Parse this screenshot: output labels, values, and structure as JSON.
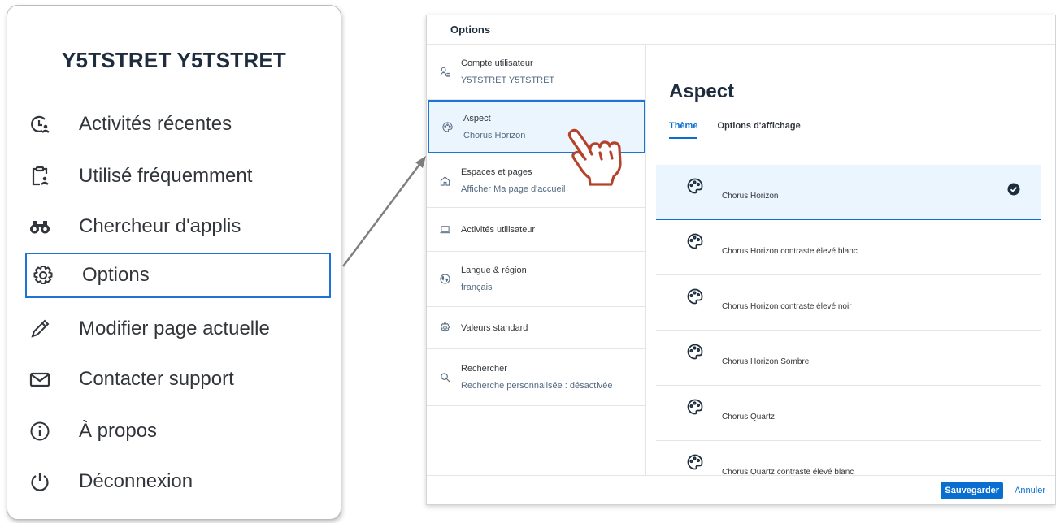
{
  "user_menu": {
    "user_name": "Y5TSTRET Y5TSTRET",
    "items": [
      {
        "label": "Activités récentes",
        "icon": "recent-activity-icon"
      },
      {
        "label": "Utilisé fréquemment",
        "icon": "frequently-used-icon"
      },
      {
        "label": "Chercheur d'applis",
        "icon": "binoculars-icon"
      },
      {
        "label": "Options",
        "icon": "gear-icon",
        "selected": true
      },
      {
        "label": "Modifier page actuelle",
        "icon": "pencil-icon"
      },
      {
        "label": "Contacter support",
        "icon": "envelope-icon"
      },
      {
        "label": "À propos",
        "icon": "info-icon"
      },
      {
        "label": "Déconnexion",
        "icon": "power-icon"
      }
    ]
  },
  "dialog": {
    "title": "Options",
    "nav": [
      {
        "title": "Compte utilisateur",
        "sub": "Y5TSTRET Y5TSTRET",
        "icon": "user-icon"
      },
      {
        "title": "Aspect",
        "sub": "Chorus Horizon",
        "icon": "palette-icon",
        "active": true
      },
      {
        "title": "Espaces et pages",
        "sub": "Afficher Ma page d'accueil",
        "icon": "home-icon"
      },
      {
        "title": "Activités utilisateur",
        "sub": "",
        "icon": "laptop-icon"
      },
      {
        "title": "Langue & région",
        "sub": "français",
        "icon": "globe-icon"
      },
      {
        "title": "Valeurs standard",
        "sub": "",
        "icon": "settings-icon"
      },
      {
        "title": "Rechercher",
        "sub": "Recherche personnalisée : désactivée",
        "icon": "search-icon"
      }
    ],
    "content_title": "Aspect",
    "tabs": [
      {
        "label": "Thème",
        "active": true
      },
      {
        "label": "Options d'affichage",
        "active": false
      }
    ],
    "themes": [
      {
        "label": "Chorus Horizon",
        "selected": true
      },
      {
        "label": "Chorus Horizon contraste élevé blanc",
        "selected": false
      },
      {
        "label": "Chorus Horizon contraste élevé noir",
        "selected": false
      },
      {
        "label": "Chorus Horizon Sombre",
        "selected": false
      },
      {
        "label": "Chorus Quartz",
        "selected": false
      },
      {
        "label": "Chorus Quartz contraste élevé blanc",
        "selected": false
      }
    ],
    "footer": {
      "save": "Sauvegarder",
      "cancel": "Annuler"
    }
  },
  "colors": {
    "accent": "#0a6ed1",
    "highlight_border": "#1e73d6",
    "selected_bg": "#ebf5fe",
    "hand_cursor": "#b5432c"
  }
}
